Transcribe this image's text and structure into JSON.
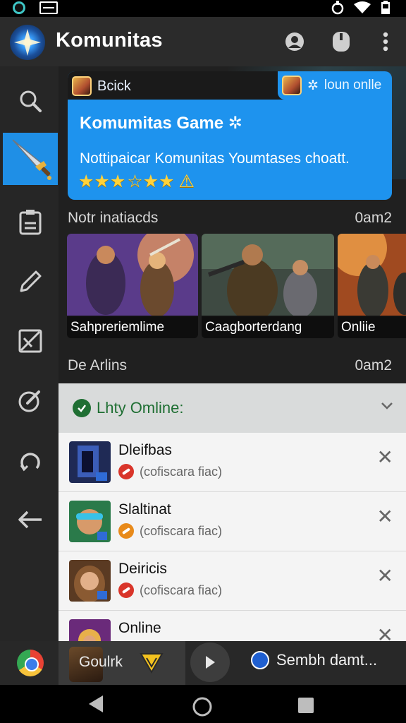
{
  "app": {
    "title": "Komunitas",
    "accent": "#1e93ee"
  },
  "sidebar": {
    "items": [
      {
        "icon": "search-icon"
      },
      {
        "icon": "sword-icon",
        "active": true
      },
      {
        "icon": "document-icon"
      },
      {
        "icon": "pencil-icon"
      },
      {
        "icon": "image-icon"
      },
      {
        "icon": "edit-circle-icon"
      },
      {
        "icon": "refresh-icon"
      },
      {
        "icon": "back-arrow-icon"
      }
    ]
  },
  "banner": {
    "left_button": "Bcick",
    "tag": "loun onlle",
    "title": "Komumitas Game",
    "description": "Nottipaicar Komunitas Youmtases choatt.",
    "stars": "★★★",
    "stars_extra": "☆★★"
  },
  "section1": {
    "label": "Notr inatiacds",
    "time": "0am2"
  },
  "cards": [
    {
      "label": "Sahpreriemlime"
    },
    {
      "label": "Caagborterdang"
    },
    {
      "label": "Onliie"
    }
  ],
  "section2": {
    "label": "De Arlins",
    "time": "0am2"
  },
  "online": {
    "title": "Lhty Omline:",
    "users": [
      {
        "name": "Dleifbas",
        "status": "(cofiscara fiac)",
        "status_color": "red"
      },
      {
        "name": "Slaltinat",
        "status": "(cofiscara fiac)",
        "status_color": "orange"
      },
      {
        "name": "Deiricis",
        "status": "(cofiscara fiac)",
        "status_color": "red"
      },
      {
        "name": "Online",
        "status": "",
        "status_color": "red"
      }
    ]
  },
  "bottombar": {
    "game_label": "Goulrk",
    "search_text": "Sembh damt..."
  }
}
